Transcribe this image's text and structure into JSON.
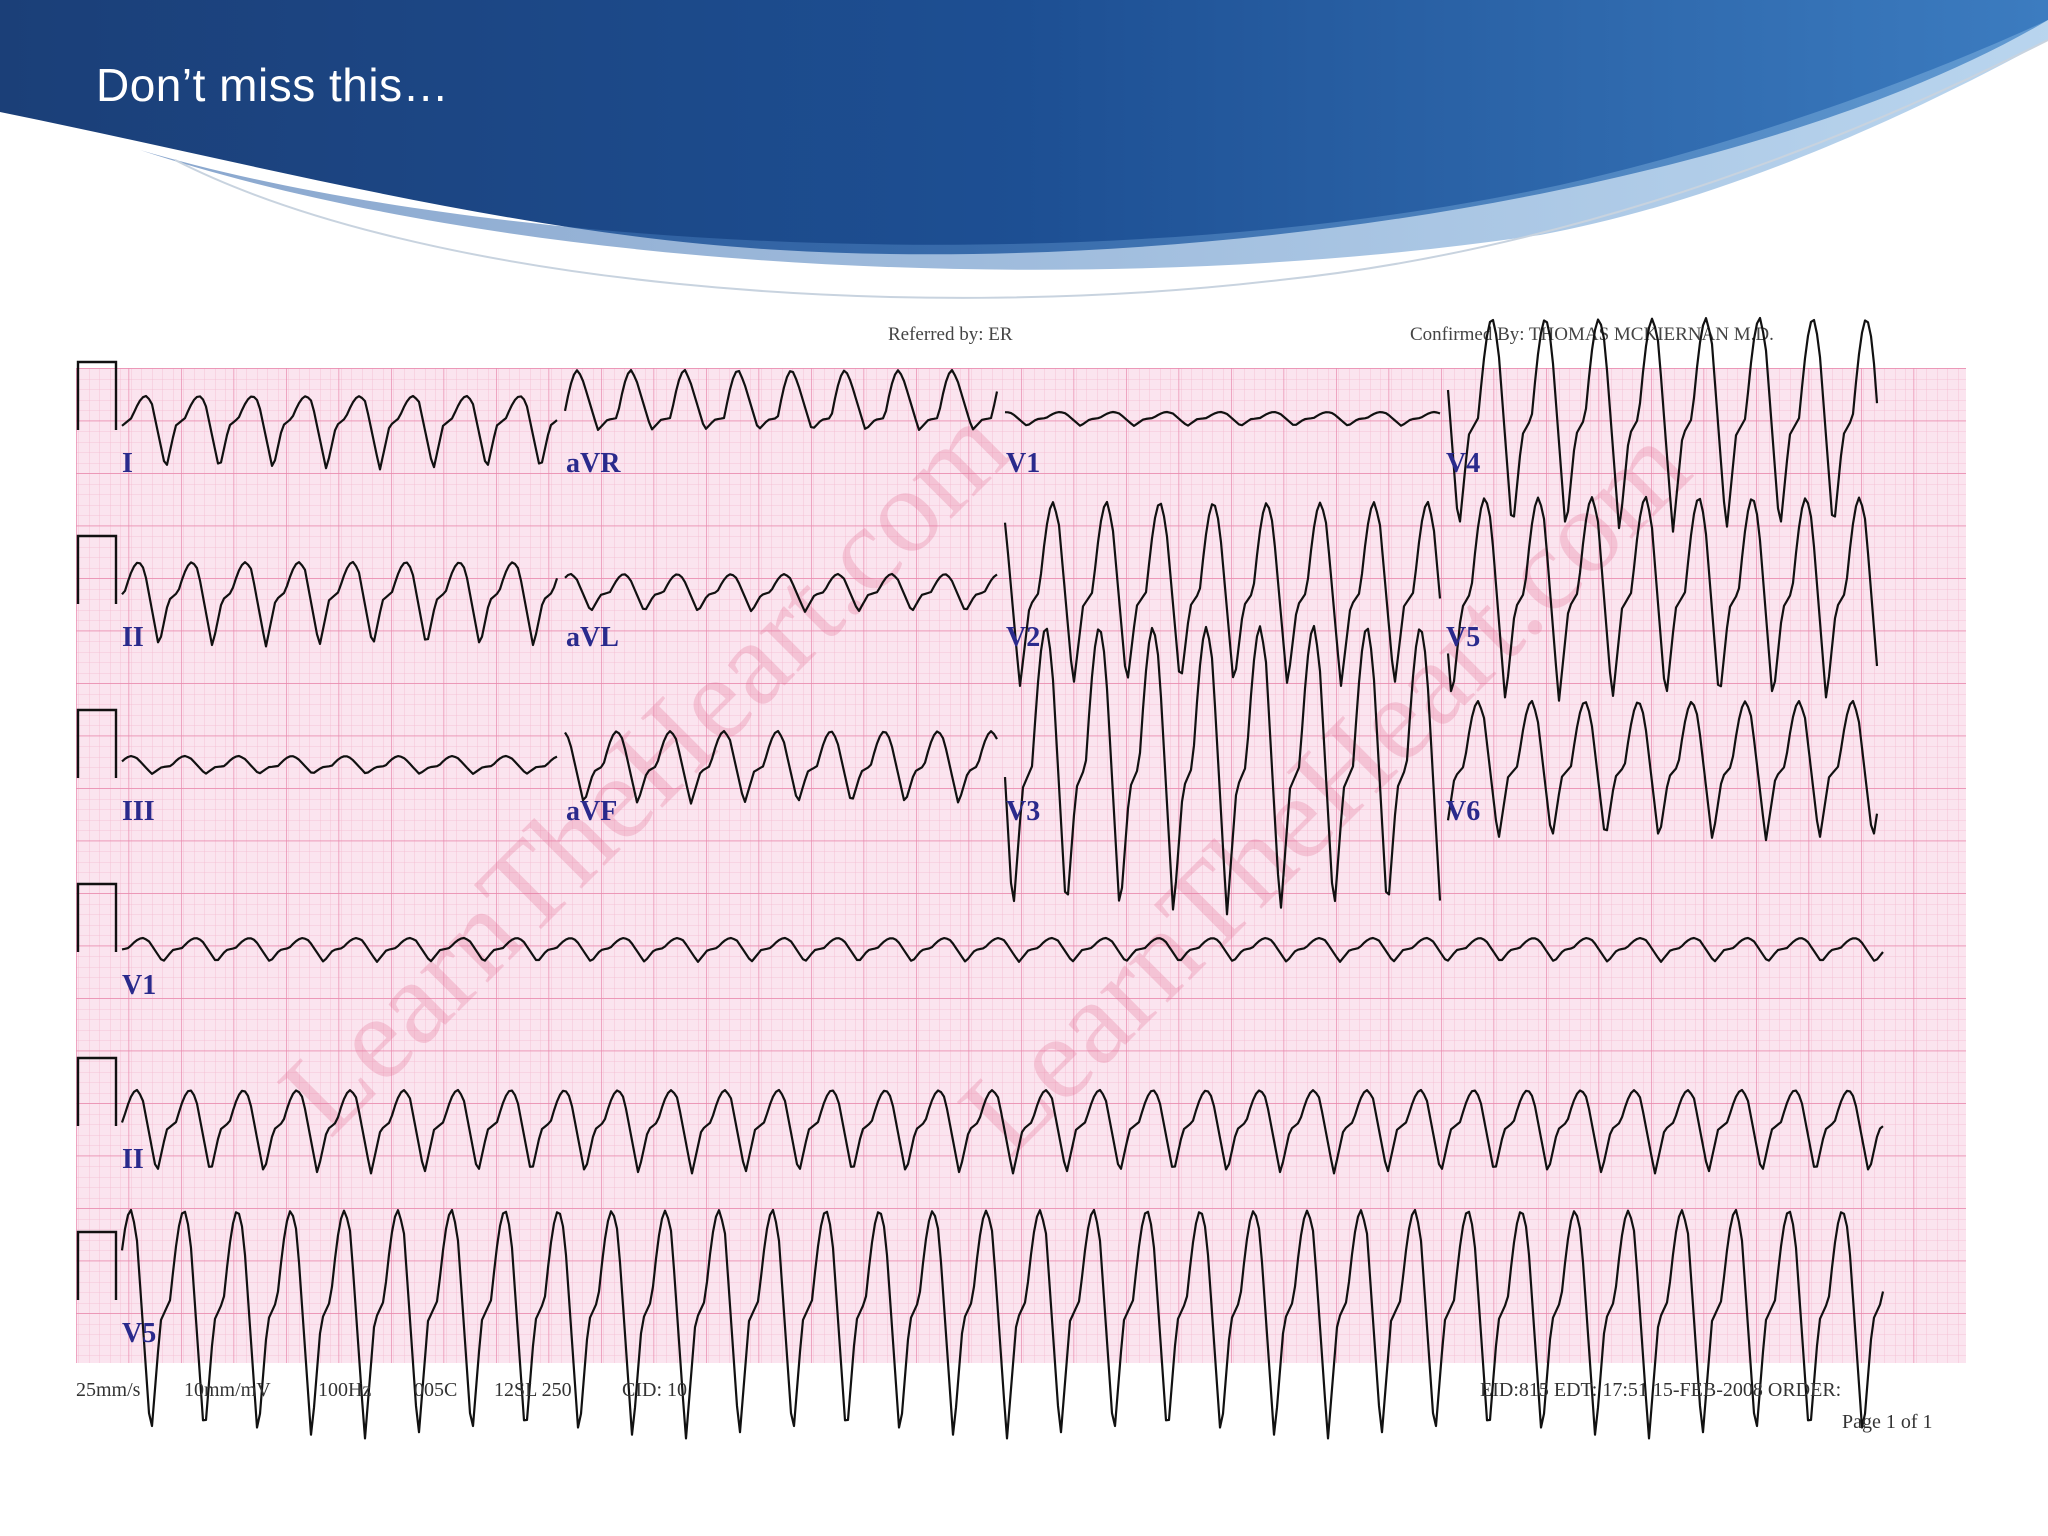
{
  "slide": {
    "title": "Don’t miss this…"
  },
  "ecg": {
    "header_left": "Referred by:   ER",
    "header_right": "Confirmed By:  THOMAS  MCKIERNAN M.D.",
    "watermark": "LearnTheHeart.com",
    "lead_labels": {
      "row1": [
        "I",
        "aVR",
        "V1",
        "V4"
      ],
      "row2": [
        "II",
        "aVL",
        "V2",
        "V5"
      ],
      "row3": [
        "III",
        "aVF",
        "V3",
        "V6"
      ],
      "rhythm1": "V1",
      "rhythm2": "II",
      "rhythm3": "V5"
    },
    "footer_items": [
      "25mm/s",
      "10mm/mV",
      "100Hz",
      "005C",
      "12SL 250",
      "CID: 10"
    ],
    "footer_right": "EID:815 EDT: 17:51 15-FEB-2008 ORDER:",
    "page_info": "Page 1 of 1",
    "colors": {
      "grid_background": "#fbe4ef",
      "grid_minor": "#f5b9d0",
      "grid_major": "#e88aae",
      "trace": "#111111",
      "label": "#2a2a8c",
      "header_blue": "#1d4d8e"
    }
  }
}
